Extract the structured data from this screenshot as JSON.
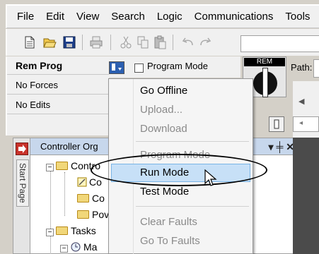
{
  "menubar": {
    "items": [
      "File",
      "Edit",
      "View",
      "Search",
      "Logic",
      "Communications",
      "Tools"
    ]
  },
  "status": {
    "mode": "Rem Prog",
    "forces": "No Forces",
    "edits": "No Edits",
    "program_mode_label": "Program Mode",
    "key_header": "REM",
    "path_label": "Path:"
  },
  "organizer": {
    "title": "Controller Org",
    "side_tab": "Start Page",
    "title_controls": "▾ ╪ ✕",
    "tree": [
      "Contro",
      "Co",
      "Co",
      "Pov",
      "Tasks",
      "Ma"
    ]
  },
  "dropdown": {
    "items": [
      {
        "label": "Go Offline",
        "disabled": false
      },
      {
        "label": "Upload...",
        "disabled": true
      },
      {
        "label": "Download",
        "disabled": true
      },
      {
        "label": "Program Mode",
        "disabled": true
      },
      {
        "label": "Run Mode",
        "disabled": false,
        "highlighted": true
      },
      {
        "label": "Test Mode",
        "disabled": false
      },
      {
        "label": "Clear Faults",
        "disabled": true
      },
      {
        "label": "Go To Faults",
        "disabled": true
      }
    ]
  },
  "colors": {
    "highlight": "#c7e0f7",
    "title_bar": "#c7d7ec",
    "side_tab_red": "#c8322a"
  }
}
